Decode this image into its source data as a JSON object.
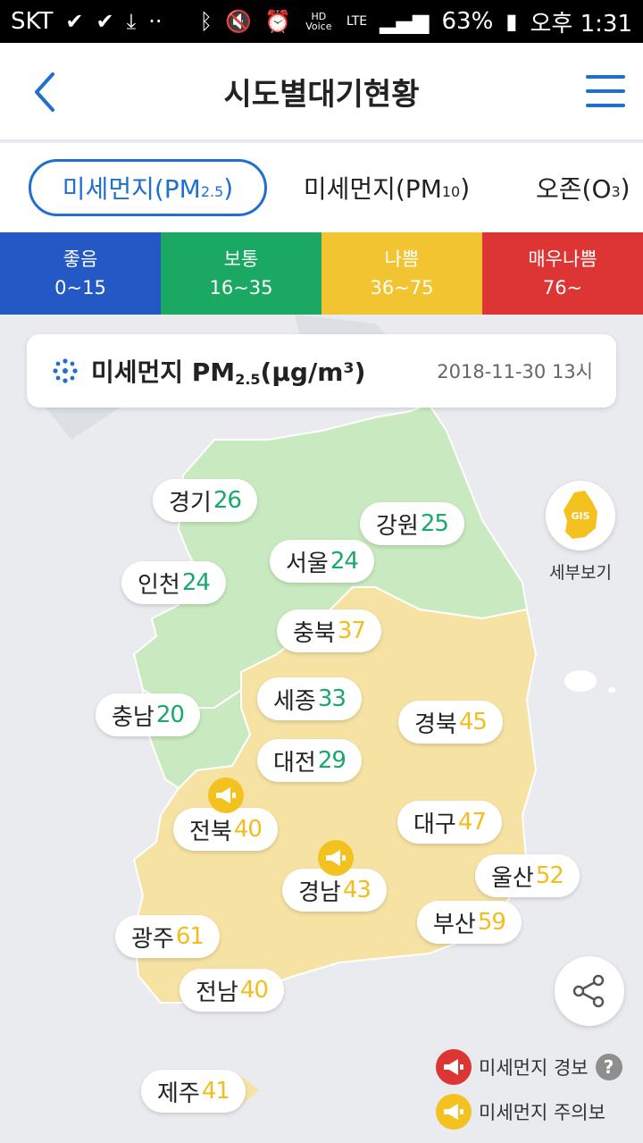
{
  "status_bar": {
    "carrier": "SKT",
    "battery": "63%",
    "time": "오후 1:31",
    "network": "LTE",
    "hd_voice": "HD Voice"
  },
  "header": {
    "title": "시도별대기현황"
  },
  "tabs": [
    {
      "label": "미세먼지(PM",
      "sub": "2.5",
      "suffix": ")",
      "active": true
    },
    {
      "label": "미세먼지(PM",
      "sub": "10",
      "suffix": ")",
      "active": false
    },
    {
      "label": "오존(O",
      "sub": "3",
      "suffix": ")",
      "active": false
    }
  ],
  "grade_legend": [
    {
      "label": "좋음",
      "range": "0~15",
      "color": "#2458c4"
    },
    {
      "label": "보통",
      "range": "16~35",
      "color": "#1aa862"
    },
    {
      "label": "나쁨",
      "range": "36~75",
      "color": "#f2c431"
    },
    {
      "label": "매우나쁨",
      "range": "76~",
      "color": "#dd3434"
    }
  ],
  "info_card": {
    "title": "미세먼지 PM",
    "sub": "2.5",
    "unit": "(μg/m³)",
    "datetime": "2018-11-30 13시"
  },
  "regions": [
    {
      "name": "경기",
      "value": "26",
      "level": "good"
    },
    {
      "name": "강원",
      "value": "25",
      "level": "good"
    },
    {
      "name": "서울",
      "value": "24",
      "level": "good"
    },
    {
      "name": "인천",
      "value": "24",
      "level": "good"
    },
    {
      "name": "충북",
      "value": "37",
      "level": "normal"
    },
    {
      "name": "세종",
      "value": "33",
      "level": "good"
    },
    {
      "name": "충남",
      "value": "20",
      "level": "good"
    },
    {
      "name": "경북",
      "value": "45",
      "level": "normal"
    },
    {
      "name": "대전",
      "value": "29",
      "level": "good"
    },
    {
      "name": "전북",
      "value": "40",
      "level": "normal"
    },
    {
      "name": "대구",
      "value": "47",
      "level": "normal"
    },
    {
      "name": "울산",
      "value": "52",
      "level": "normal"
    },
    {
      "name": "경남",
      "value": "43",
      "level": "normal"
    },
    {
      "name": "부산",
      "value": "59",
      "level": "normal"
    },
    {
      "name": "광주",
      "value": "61",
      "level": "normal"
    },
    {
      "name": "전남",
      "value": "40",
      "level": "normal"
    },
    {
      "name": "제주",
      "value": "41",
      "level": "normal"
    }
  ],
  "gis_button": {
    "icon_text": "GIS",
    "label": "세부보기"
  },
  "warnings": {
    "alert_label": "미세먼지 경보",
    "watch_label": "미세먼지 주의보",
    "help": "?"
  },
  "colors": {
    "accent": "#1f6fcf",
    "good_text": "#1aa86b",
    "normal_text": "#f2bd1d",
    "map_good": "#c9eac0",
    "map_normal": "#f6e3a4"
  }
}
